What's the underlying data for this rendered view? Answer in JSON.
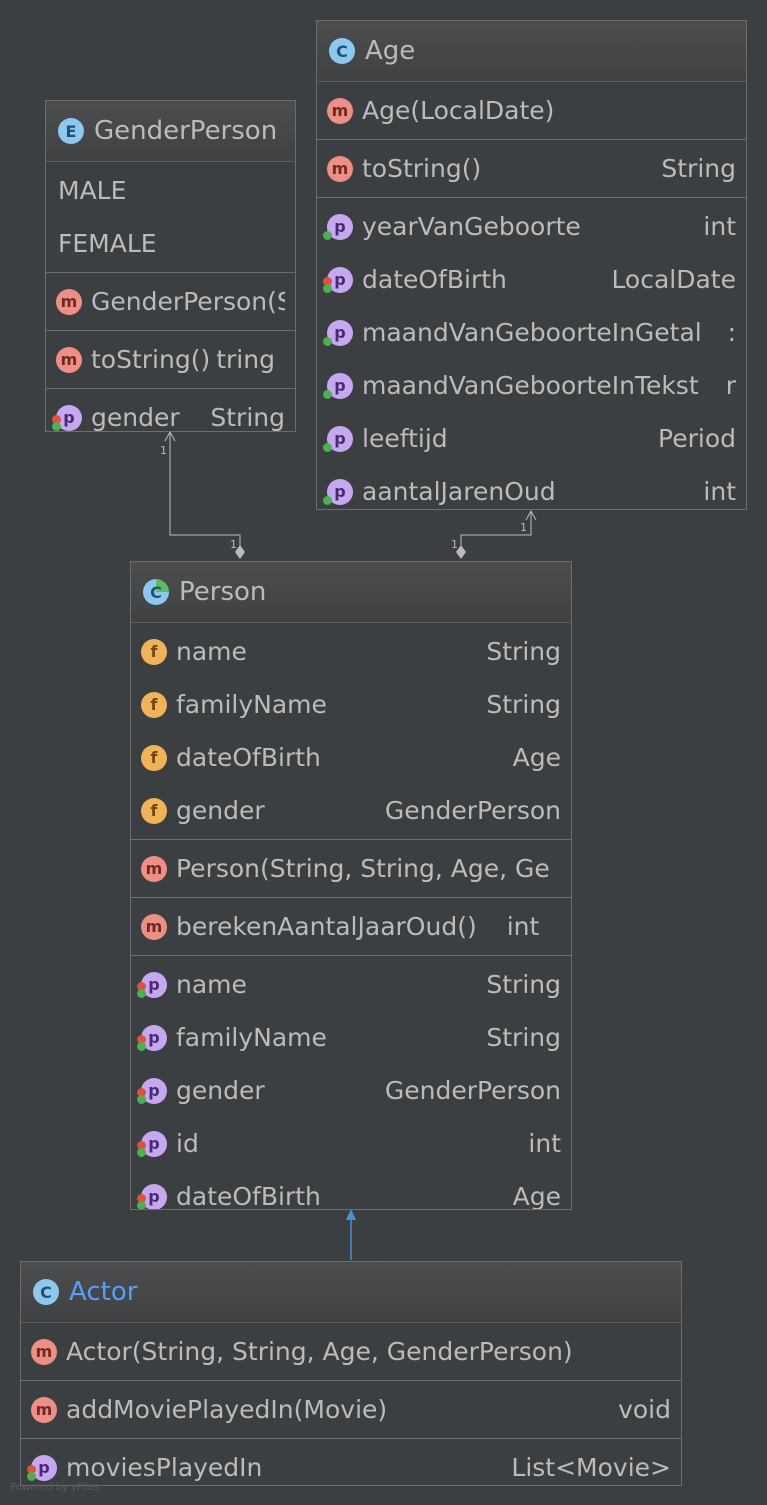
{
  "gender_person": {
    "kind_icon": "E",
    "title": "GenderPerson",
    "constants": [
      "MALE",
      "FEMALE"
    ],
    "constructor": "GenderPerson(S",
    "methods": [
      {
        "icon": "m",
        "name": "toString()",
        "type": "tring"
      }
    ],
    "properties": [
      {
        "icon": "p",
        "name": "gender",
        "type": "String"
      }
    ]
  },
  "age": {
    "kind_icon": "C",
    "title": "Age",
    "constructor": "Age(LocalDate)",
    "methods": [
      {
        "icon": "m",
        "name": "toString()",
        "type": "String"
      }
    ],
    "properties": [
      {
        "icon": "p",
        "name": "yearVanGeboorte",
        "type": "int"
      },
      {
        "icon": "p",
        "name": "dateOfBirth",
        "type": "LocalDate"
      },
      {
        "icon": "p",
        "name": "maandVanGeboorteInGetal",
        "type": ":"
      },
      {
        "icon": "p",
        "name": "maandVanGeboorteInTekst",
        "type": "r"
      },
      {
        "icon": "p",
        "name": "leeftijd",
        "type": "Period"
      },
      {
        "icon": "p",
        "name": "aantalJarenOud",
        "type": "int"
      }
    ]
  },
  "person": {
    "kind_icon": "C",
    "title": "Person",
    "fields": [
      {
        "icon": "f",
        "name": "name",
        "type": "String"
      },
      {
        "icon": "f",
        "name": "familyName",
        "type": "String"
      },
      {
        "icon": "f",
        "name": "dateOfBirth",
        "type": "Age"
      },
      {
        "icon": "f",
        "name": "gender",
        "type": "GenderPerson"
      }
    ],
    "constructor": "Person(String, String, Age, Ge",
    "methods": [
      {
        "icon": "m",
        "name": "berekenAantalJaarOud()",
        "type": "int"
      }
    ],
    "properties": [
      {
        "icon": "p",
        "name": "name",
        "type": "String"
      },
      {
        "icon": "p",
        "name": "familyName",
        "type": "String"
      },
      {
        "icon": "p",
        "name": "gender",
        "type": "GenderPerson"
      },
      {
        "icon": "p",
        "name": "id",
        "type": "int"
      },
      {
        "icon": "p",
        "name": "dateOfBirth",
        "type": "Age"
      }
    ]
  },
  "actor": {
    "kind_icon": "C",
    "title": "Actor",
    "constructor": "Actor(String, String, Age, GenderPerson)",
    "methods": [
      {
        "icon": "m",
        "name": "addMoviePlayedIn(Movie)",
        "type": "void"
      }
    ],
    "properties": [
      {
        "icon": "p",
        "name": "moviesPlayedIn",
        "type": "List<Movie>"
      }
    ]
  },
  "relations": {
    "gender_multiplicity_target": "1",
    "gender_multiplicity_source": "1",
    "age_multiplicity_target": "1",
    "age_multiplicity_source": "1"
  },
  "colors": {
    "background": "#3c3f41",
    "inheritance_arrow": "#4a90d9",
    "actor_title": "#589df6",
    "method_icon": "#ee8f86",
    "field_icon": "#f0b35a",
    "property_icon": "#c5a8f0",
    "class_icon": "#8ec8ee"
  },
  "watermark": "Powered by yFiles"
}
